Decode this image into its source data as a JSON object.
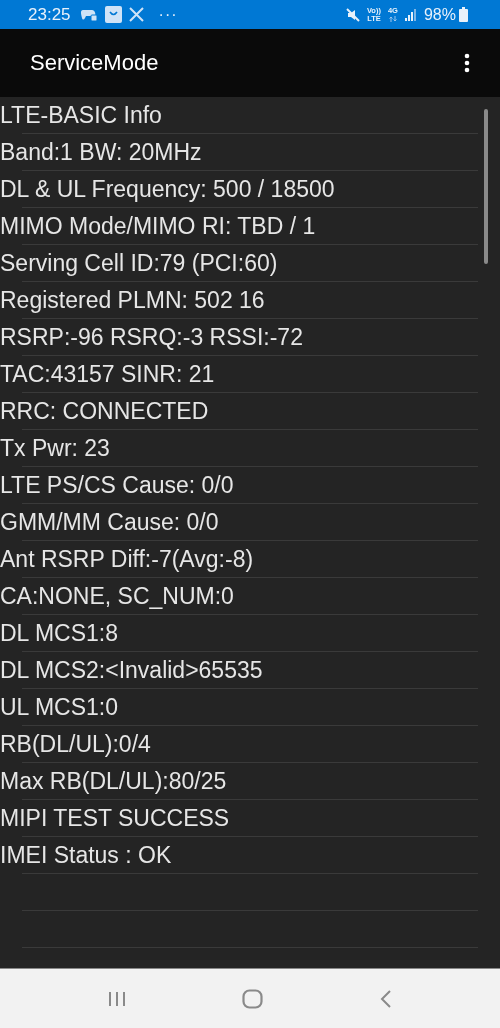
{
  "status_bar": {
    "time": "23:25",
    "notifications_more": "···",
    "volte": [
      "Vo))",
      "LTE"
    ],
    "network_type": "4G",
    "battery": "98%"
  },
  "app_bar": {
    "title": "ServiceMode"
  },
  "info_rows": [
    {
      "text": "LTE-BASIC Info"
    },
    {
      "text": "Band:1 BW: 20MHz"
    },
    {
      "text": "DL & UL Frequency: 500 / 18500"
    },
    {
      "text": "MIMO Mode/MIMO RI: TBD / 1"
    },
    {
      "text": "Serving Cell ID:79 (PCI:60)"
    },
    {
      "text": "Registered PLMN: 502 16"
    },
    {
      "text": "RSRP:-96 RSRQ:-3 RSSI:-72"
    },
    {
      "text": "TAC:43157 SINR: 21"
    },
    {
      "text": "RRC: CONNECTED"
    },
    {
      "text": "Tx Pwr: 23"
    },
    {
      "text": "LTE PS/CS Cause: 0/0"
    },
    {
      "text": "GMM/MM Cause: 0/0"
    },
    {
      "text": "Ant RSRP Diff:-7(Avg:-8)"
    },
    {
      "text": "CA:NONE, SC_NUM:0"
    },
    {
      "text": "DL MCS1:8"
    },
    {
      "text": "DL MCS2:<Invalid>65535"
    },
    {
      "text": "UL MCS1:0"
    },
    {
      "text": "RB(DL/UL):0/4"
    },
    {
      "text": "Max RB(DL/UL):80/25"
    },
    {
      "text": "MIPI TEST SUCCESS"
    },
    {
      "text": "IMEI Status : OK"
    }
  ]
}
